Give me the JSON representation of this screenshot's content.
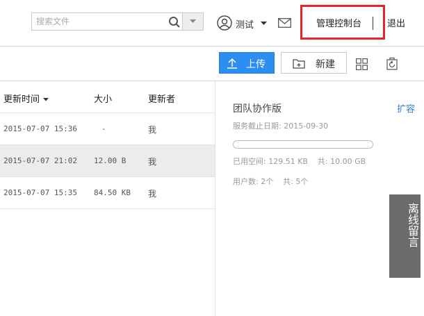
{
  "header": {
    "search": {
      "placeholder": "搜索文件",
      "value": ""
    },
    "user": {
      "name": "测试"
    },
    "console_label": "管理控制台",
    "logout_label": "退出",
    "highlight_color": "#e8232a"
  },
  "toolbar": {
    "upload_label": "上传",
    "new_label": "新建",
    "accent_color": "#2d8ef2"
  },
  "file_list": {
    "columns": {
      "time": "更新时间",
      "size": "大小",
      "updater": "更新者"
    },
    "rows": [
      {
        "time": "2015-07-07 15:36",
        "size": "-",
        "updater": "我",
        "selected": false
      },
      {
        "time": "2015-07-07 21:02",
        "size": "12.00 B",
        "updater": "我",
        "selected": true
      },
      {
        "time": "2015-07-07 15:35",
        "size": "84.50 KB",
        "updater": "我",
        "selected": false
      }
    ]
  },
  "team_panel": {
    "title": "团队协作版",
    "expand_label": "扩容",
    "expiry": "服务截止日期: 2015-09-30",
    "used_space": "已用空间: 129.51 KB    共: 10.00 GB",
    "usage_fraction": 0,
    "user_count": "用户数: 2个    共: 5个"
  },
  "message_tab": {
    "label": "离线留言"
  }
}
